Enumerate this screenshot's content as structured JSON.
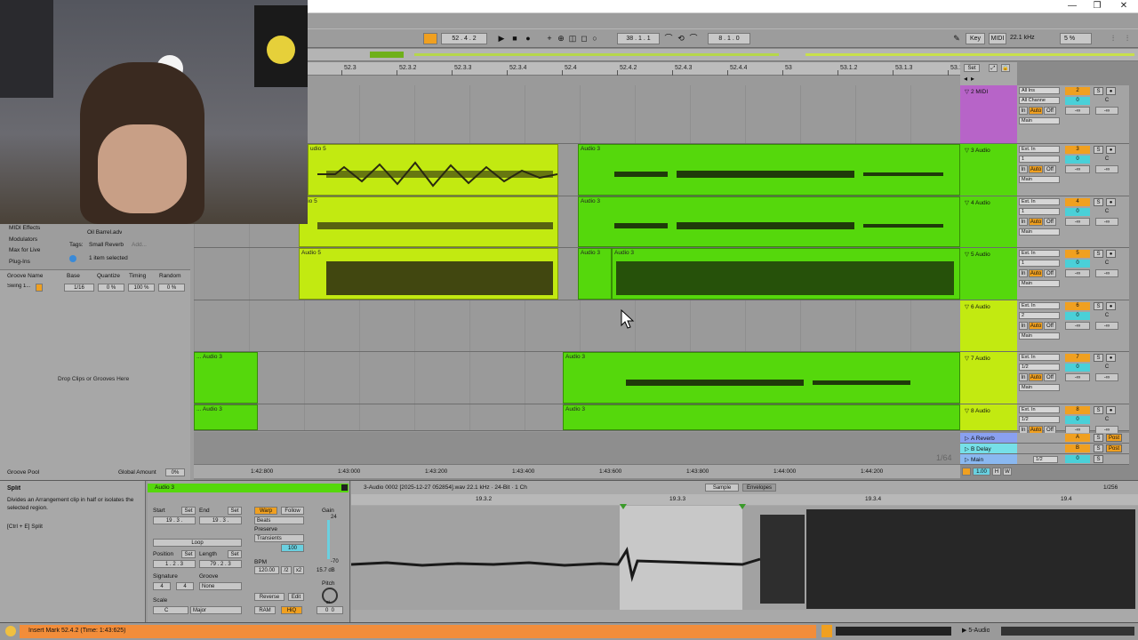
{
  "window": {
    "minimize": "—",
    "restore": "❐",
    "close": "✕"
  },
  "transport": {
    "position": "52 .  4 .  2",
    "loop_start": "38 .  1 .  1",
    "loop_length": "8 .  1 .  0",
    "key_label": "Key",
    "midi_label": "MIDI",
    "sample_rate": "22.1 kHz",
    "cpu": "5 %"
  },
  "ruler": {
    "labels": [
      "52.3",
      "52.3.2",
      "52.3.3",
      "52.3.4",
      "52.4",
      "52.4.2",
      "52.4.3",
      "52.4.4",
      "53",
      "53.1.2",
      "53.1.3",
      "53.1.4"
    ],
    "set_label": "Set"
  },
  "time_ruler": {
    "labels": [
      "1:42:800",
      "1:43:000",
      "1:43:200",
      "1:43:400",
      "1:43:600",
      "1:43:800",
      "1:44:000",
      "1:44:200"
    ],
    "zoom": "1/64"
  },
  "tracks": [
    {
      "name": "2 MIDI",
      "color": "#b764c8",
      "input": "All Ins",
      "channel": "All Channe",
      "output": "Main",
      "num": "2"
    },
    {
      "name": "3 Audio",
      "color": "#55d80c",
      "input": "Ext. In",
      "channel": "1",
      "output": "Main",
      "num": "3"
    },
    {
      "name": "4 Audio",
      "color": "#55d80c",
      "input": "Ext. In",
      "channel": "1",
      "output": "Main",
      "num": "4"
    },
    {
      "name": "5 Audio",
      "color": "#55d80c",
      "input": "Ext. In",
      "channel": "1",
      "output": "Main",
      "num": "5"
    },
    {
      "name": "6 Audio",
      "color": "#c2ea11",
      "input": "Ext. In",
      "channel": "2",
      "output": "Main",
      "num": "6"
    },
    {
      "name": "7 Audio",
      "color": "#c2ea11",
      "input": "Ext. In",
      "channel": "1/2",
      "output": "Main",
      "num": "7"
    },
    {
      "name": "8 Audio",
      "color": "#c2ea11",
      "input": "Ext. In",
      "channel": "1/2",
      "output": "",
      "num": "8"
    }
  ],
  "returns": [
    {
      "name": "A Reverb",
      "letter": "A",
      "color": "#8aa0f0"
    },
    {
      "name": "B Delay",
      "letter": "B",
      "color": "#76e0e8"
    },
    {
      "name": "Main",
      "letter": "0",
      "color": "#8ab8f0"
    }
  ],
  "mixer": {
    "solo": "S",
    "vol": "0",
    "pan": "C",
    "inf": "-∞",
    "in": "In",
    "auto": "Auto",
    "off": "Off",
    "post": "Post",
    "main_out": "1/2"
  },
  "clips": {
    "audio5": "Audio 5",
    "audio3": "Audio 3",
    "audio5_short": "udio 5",
    "audio3_trunc": "... Audio 3"
  },
  "browser": {
    "items": [
      "MIDI Effects",
      "Modulators",
      "Max for Live",
      "Plug-Ins"
    ],
    "file": "Oil Barrel.adv",
    "tags_label": "Tags:",
    "tags_value": "Small Reverb",
    "tags_add": "Add...",
    "selected": "1 item selected"
  },
  "groove": {
    "headers": [
      "Groove Name",
      "Base",
      "Quantize",
      "Timing",
      "Random"
    ],
    "row": {
      "name": "Swing 1...",
      "base": "1/16",
      "quantize": "0 %",
      "timing": "100 %",
      "random": "0 %"
    },
    "drop": "Drop Clips or Grooves Here",
    "pool": "Groove Pool",
    "global_label": "Global Amount",
    "global_value": "0%"
  },
  "info": {
    "title": "Split",
    "desc": "Divides an Arrangement clip in half or isolates the selected region.",
    "shortcut": "[Ctrl + E] Split"
  },
  "clip_view": {
    "name": "Audio 3",
    "start_label": "Start",
    "end_label": "End",
    "set": "Set",
    "start": "19 .  3 .  ",
    "end": "19 .  3 .  ",
    "loop": "Loop",
    "position_label": "Position",
    "length_label": "Length",
    "position": "1 .  2 .  3",
    "length": "79 .  2 .  3",
    "signature_label": "Signature",
    "groove_label": "Groove",
    "sig_num": "4",
    "sig_den": "4",
    "groove_value": "None",
    "scale_label": "Scale",
    "scale_root": "C",
    "scale_mode": "Major",
    "warp": "Warp",
    "follow": "Follow",
    "beats": "Beats",
    "preserve": "Preserve",
    "transients": "Transients",
    "transient_val": "100",
    "bpm_label": "BPM",
    "bpm": "120.00",
    "half": "/2",
    "double": "x2",
    "reverse": "Reverse",
    "edit": "Edit",
    "ram": "RAM",
    "hiq": "HiQ",
    "gain_label": "Gain",
    "gain_db": "15.7 dB",
    "gain_top": "24",
    "gain_bottom": "-70",
    "pitch_label": "Pitch",
    "pitch_st": "st",
    "pitch_a": "0",
    "pitch_b": "0"
  },
  "sample_editor": {
    "file": "3-Audio 0002 [2025-12-27 052854].wav  22.1 kHz · 24-Bit · 1 Ch",
    "tab_sample": "Sample",
    "tab_env": "Envelopes",
    "zoom": "1/256",
    "ruler": [
      "19.3.2",
      "19.3.3",
      "19.3.4",
      "19.4"
    ]
  },
  "status": {
    "message": "Insert Mark 52.4.2 (Time: 1:43:625)",
    "track": "5-Audio"
  },
  "colors": {
    "green": "#55d80c",
    "lime": "#c2ea11",
    "orange": "#f28d3a",
    "purple": "#b764c8"
  }
}
